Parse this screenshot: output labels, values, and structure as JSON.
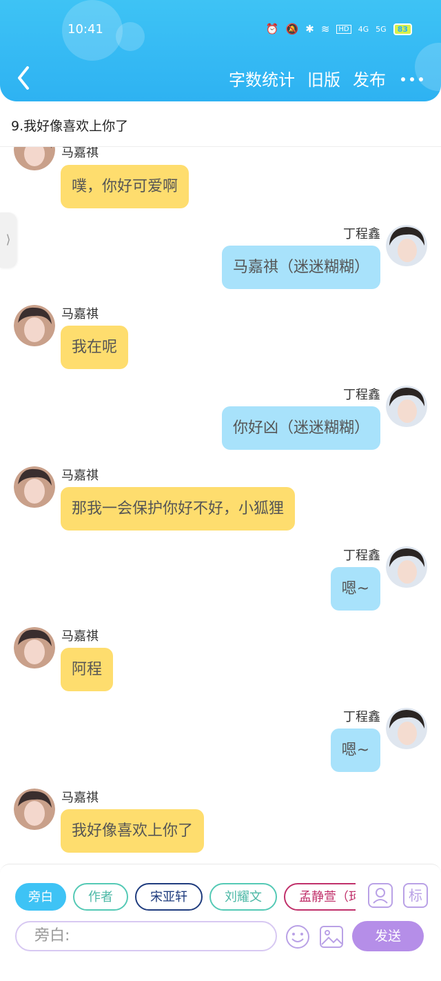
{
  "status_bar": {
    "time": "10:41",
    "battery": "83",
    "network_4g": "4G",
    "network_5g": "5G",
    "hd_label": "HD"
  },
  "nav": {
    "word_count": "字数统计",
    "old_version": "旧版",
    "publish": "发布"
  },
  "chapter": {
    "title": "9.我好像喜欢上你了"
  },
  "side_tab": {
    "label": "⟩"
  },
  "messages": [
    {
      "speaker": "马嘉祺",
      "text": "噗，你好可爱啊",
      "side": "left"
    },
    {
      "speaker": "丁程鑫",
      "text": "马嘉祺（迷迷糊糊）",
      "side": "right"
    },
    {
      "speaker": "马嘉祺",
      "text": "我在呢",
      "side": "left"
    },
    {
      "speaker": "丁程鑫",
      "text": "你好凶（迷迷糊糊）",
      "side": "right"
    },
    {
      "speaker": "马嘉祺",
      "text": "那我一会保护你好不好，小狐狸",
      "side": "left"
    },
    {
      "speaker": "丁程鑫",
      "text": "嗯~",
      "side": "right"
    },
    {
      "speaker": "马嘉祺",
      "text": "阿程",
      "side": "left"
    },
    {
      "speaker": "丁程鑫",
      "text": "嗯~",
      "side": "right"
    },
    {
      "speaker": "马嘉祺",
      "text": "我好像喜欢上你了",
      "side": "left"
    }
  ],
  "roles": [
    "旁白",
    "作者",
    "宋亚轩",
    "刘耀文",
    "孟静萱（珂"
  ],
  "tools": {
    "tag_label": "标"
  },
  "composer": {
    "placeholder": "旁白:",
    "send": "发送"
  },
  "colors": {
    "header": "#3ec3f5",
    "left_bubble": "#fedd6e",
    "right_bubble": "#a8e2fb",
    "send": "#b58ee8"
  }
}
